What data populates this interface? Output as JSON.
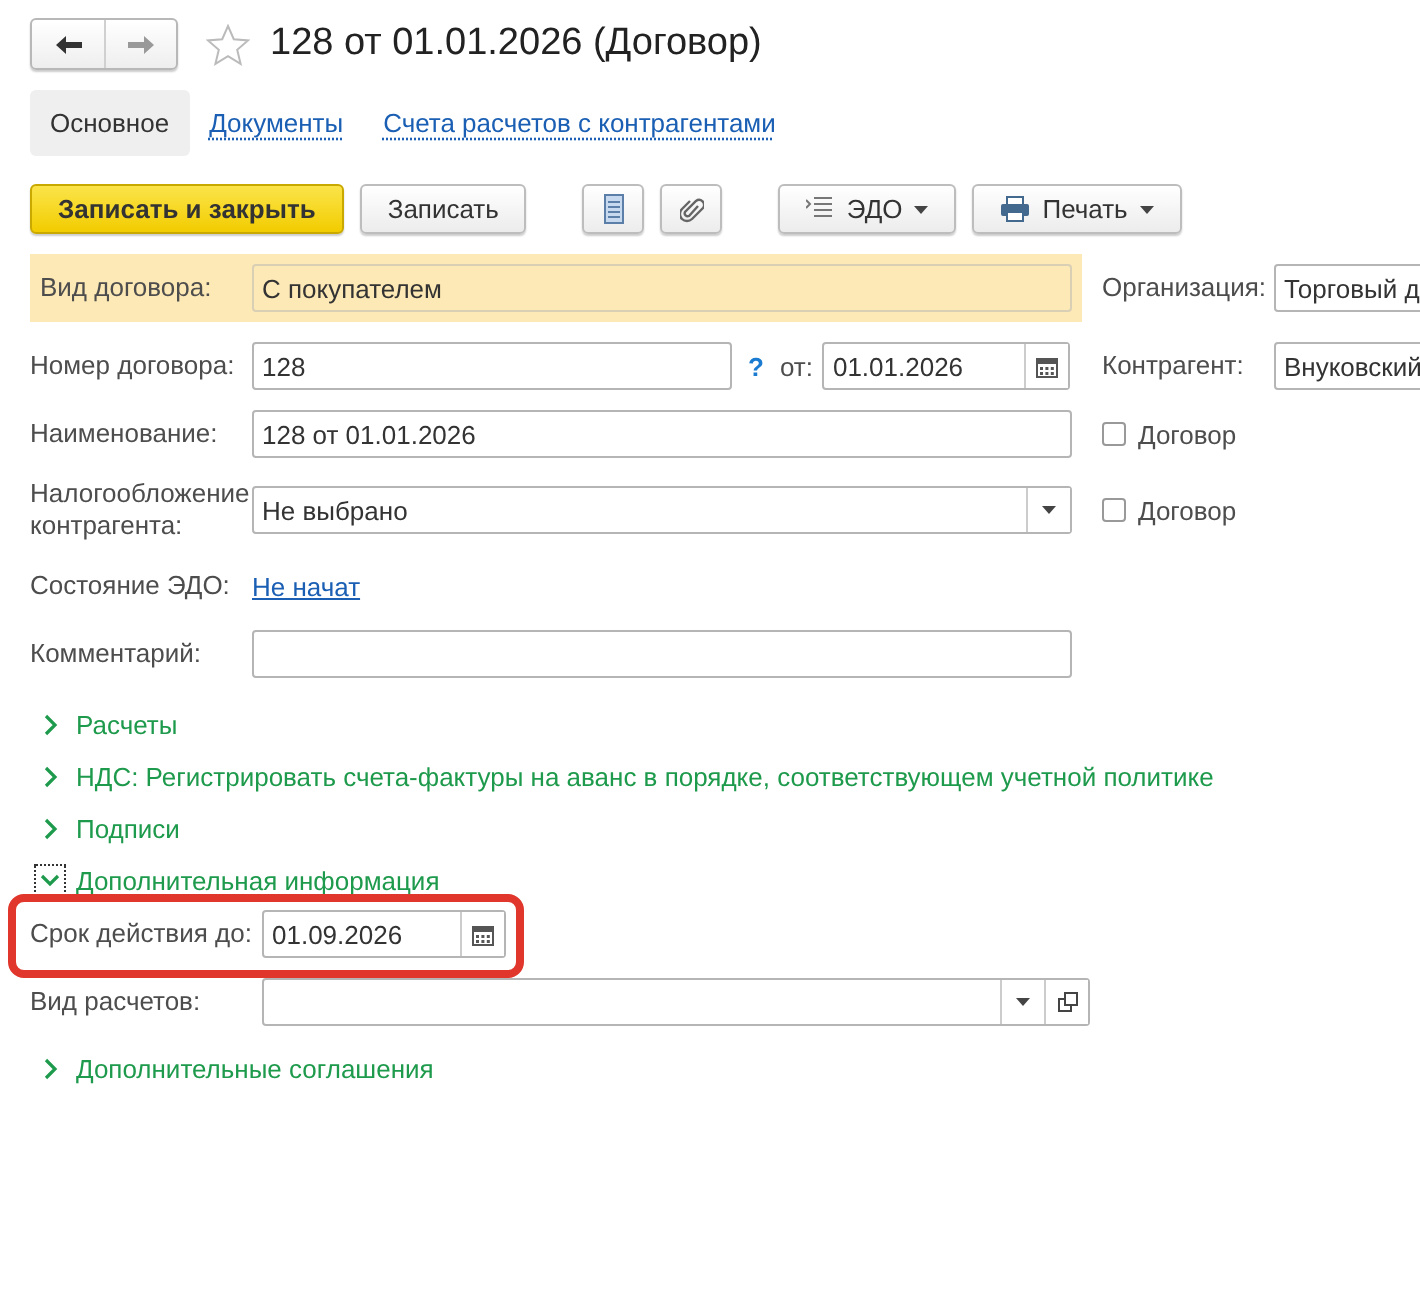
{
  "header": {
    "title": "128 от 01.01.2026 (Договор)",
    "favorite": false
  },
  "tabs": [
    {
      "label": "Основное",
      "selected": true
    },
    {
      "label": "Документы",
      "selected": false
    },
    {
      "label": "Счета расчетов с контрагентами",
      "selected": false
    }
  ],
  "toolbar": {
    "save_close": "Записать и закрыть",
    "save": "Записать",
    "edo_menu": "ЭДО",
    "print_menu": "Печать"
  },
  "rows": [
    {
      "left": {
        "label": "Вид договора:",
        "kind": "text",
        "value": "С покупателем",
        "highlighted": true
      },
      "right": {
        "kind": "field",
        "label": "Организация:",
        "value": "Торговый д"
      }
    },
    {
      "left": {
        "label": "Номер договора:",
        "kind": "number",
        "value": "128",
        "help": "?",
        "date_label": "от:",
        "date": "01.01.2026"
      },
      "right": {
        "kind": "field",
        "label": "Контрагент:",
        "value": "Внуковский"
      }
    },
    {
      "left": {
        "label": "Наименование:",
        "kind": "text",
        "value": "128 от 01.01.2026"
      },
      "right": {
        "kind": "checkbox",
        "label": "Договор",
        "checked": false
      }
    },
    {
      "left": {
        "label": "Налогообложение контрагента:",
        "kind": "select",
        "value": "Не выбрано"
      },
      "right": {
        "kind": "checkbox",
        "label": "Договор",
        "checked": false
      }
    },
    {
      "left": {
        "label": "Состояние ЭДО:",
        "kind": "link",
        "value": "Не начат"
      }
    },
    {
      "left": {
        "label": "Комментарий:",
        "kind": "text"
      }
    }
  ],
  "groups": [
    {
      "title": "Расчеты",
      "expanded": false,
      "focused": false
    },
    {
      "title": "НДС: Регистрировать счета-фактуры на аванс в порядке, соответствующем учетной политике",
      "expanded": false,
      "focused": false
    },
    {
      "title": "Подписи",
      "expanded": false,
      "focused": false
    },
    {
      "title": "Дополнительная информация",
      "expanded": true,
      "focused": true,
      "fields": [
        {
          "label": "Срок действия до:",
          "kind": "date",
          "value": "01.09.2026",
          "highlighted": true
        },
        {
          "label": "Вид расчетов:",
          "kind": "select-open"
        }
      ]
    },
    {
      "title": "Дополнительные соглашения",
      "expanded": false,
      "focused": false
    }
  ]
}
